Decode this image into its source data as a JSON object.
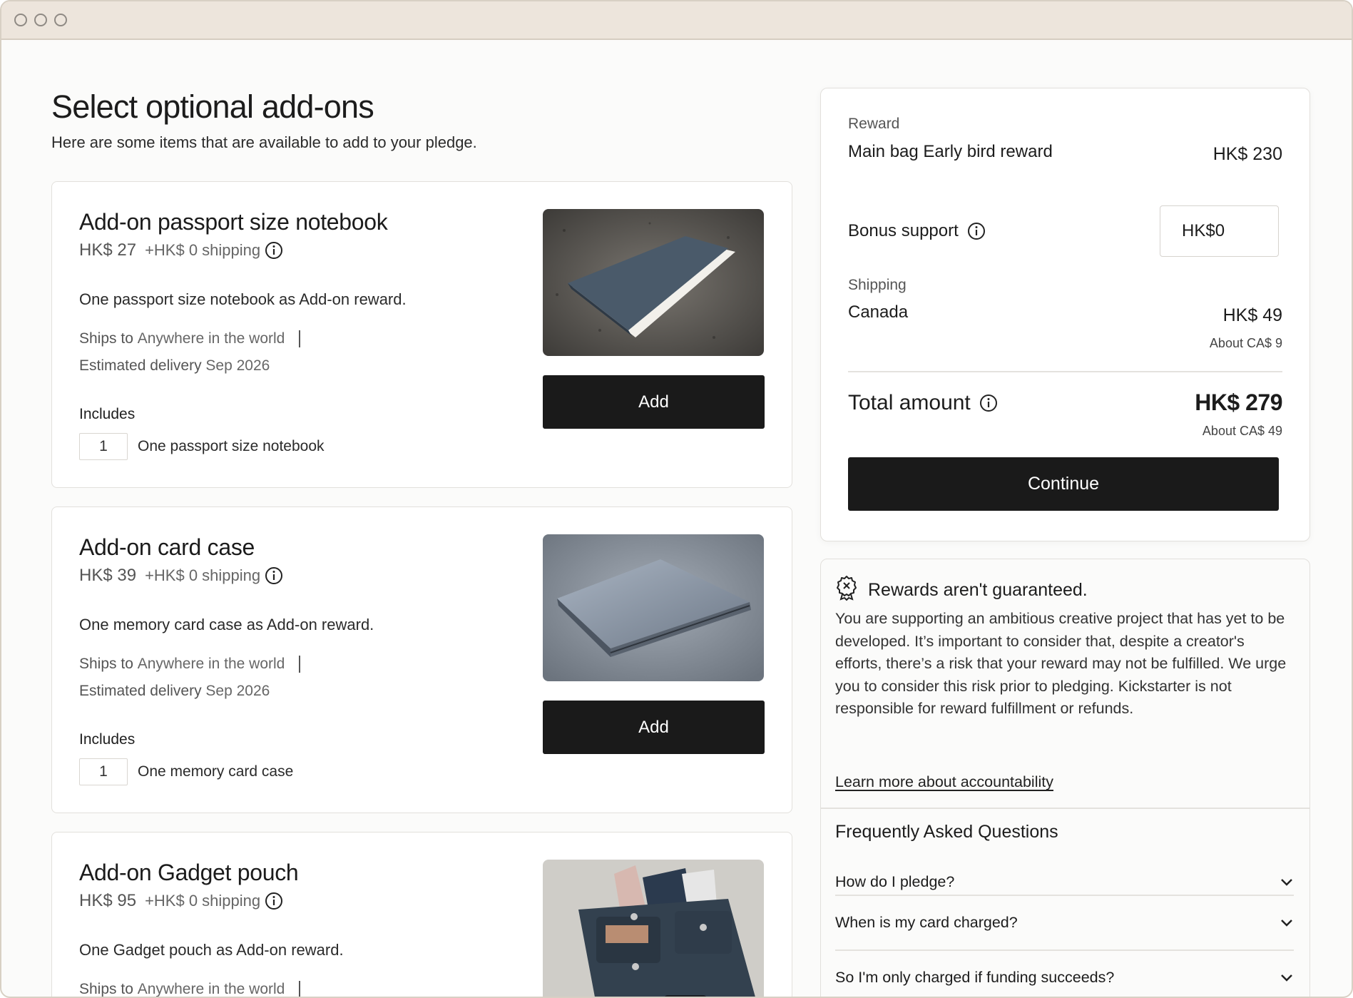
{
  "header": {
    "title": "Select optional add-ons",
    "subtitle": "Here are some items that are available to add to your pledge."
  },
  "addons": [
    {
      "name": "Add-on passport size notebook",
      "price": "HK$ 27",
      "shipping": "+HK$ 0 shipping",
      "description": "One passport size notebook as Add-on reward.",
      "ships_to_label": "Ships to",
      "ships_to_value": "Anywhere in the world",
      "delivery_label": "Estimated delivery",
      "delivery_value": "Sep 2026",
      "includes_label": "Includes",
      "includes_qty": "1",
      "includes_item": "One passport size notebook",
      "add_label": "Add",
      "image": "notebook-photo"
    },
    {
      "name": "Add-on card case",
      "price": "HK$ 39",
      "shipping": "+HK$ 0 shipping",
      "description": "One memory card case as Add-on reward.",
      "ships_to_label": "Ships to",
      "ships_to_value": "Anywhere in the world",
      "delivery_label": "Estimated delivery",
      "delivery_value": "Sep 2026",
      "includes_label": "Includes",
      "includes_qty": "1",
      "includes_item": "One memory card case",
      "add_label": "Add",
      "image": "card-case-photo"
    },
    {
      "name": "Add-on Gadget pouch",
      "price": "HK$ 95",
      "shipping": "+HK$ 0 shipping",
      "description": "One Gadget pouch as Add-on reward.",
      "ships_to_label": "Ships to",
      "ships_to_value": "Anywhere in the world",
      "image": "gadget-pouch-photo"
    }
  ],
  "summary": {
    "reward_label": "Reward",
    "reward_name": "Main bag Early bird reward",
    "reward_price": "HK$ 230",
    "bonus_label": "Bonus support",
    "bonus_value": "HK$0",
    "shipping_label": "Shipping",
    "shipping_country": "Canada",
    "shipping_price": "HK$ 49",
    "shipping_converted": "About CA$ 9",
    "total_label": "Total amount",
    "total_price": "HK$ 279",
    "total_converted": "About CA$ 49",
    "continue_label": "Continue"
  },
  "notice": {
    "title": "Rewards aren't guaranteed.",
    "body": "You are supporting an ambitious creative project that has yet to be developed. It’s important to consider that, despite a creator's efforts, there’s a risk that your reward may not be fulfilled. We urge you to consider this risk prior to pledging. Kickstarter is not responsible for reward fulfillment or refunds.",
    "link": "Learn more about accountability"
  },
  "faq": {
    "title": "Frequently Asked Questions",
    "items": [
      "How do I pledge?",
      "When is my card charged?",
      "So I'm only charged if funding succeeds?"
    ]
  },
  "colors": {
    "accent": "#1a1a1a",
    "titlebar": "#ede5dc",
    "background": "#fbfbfa"
  }
}
